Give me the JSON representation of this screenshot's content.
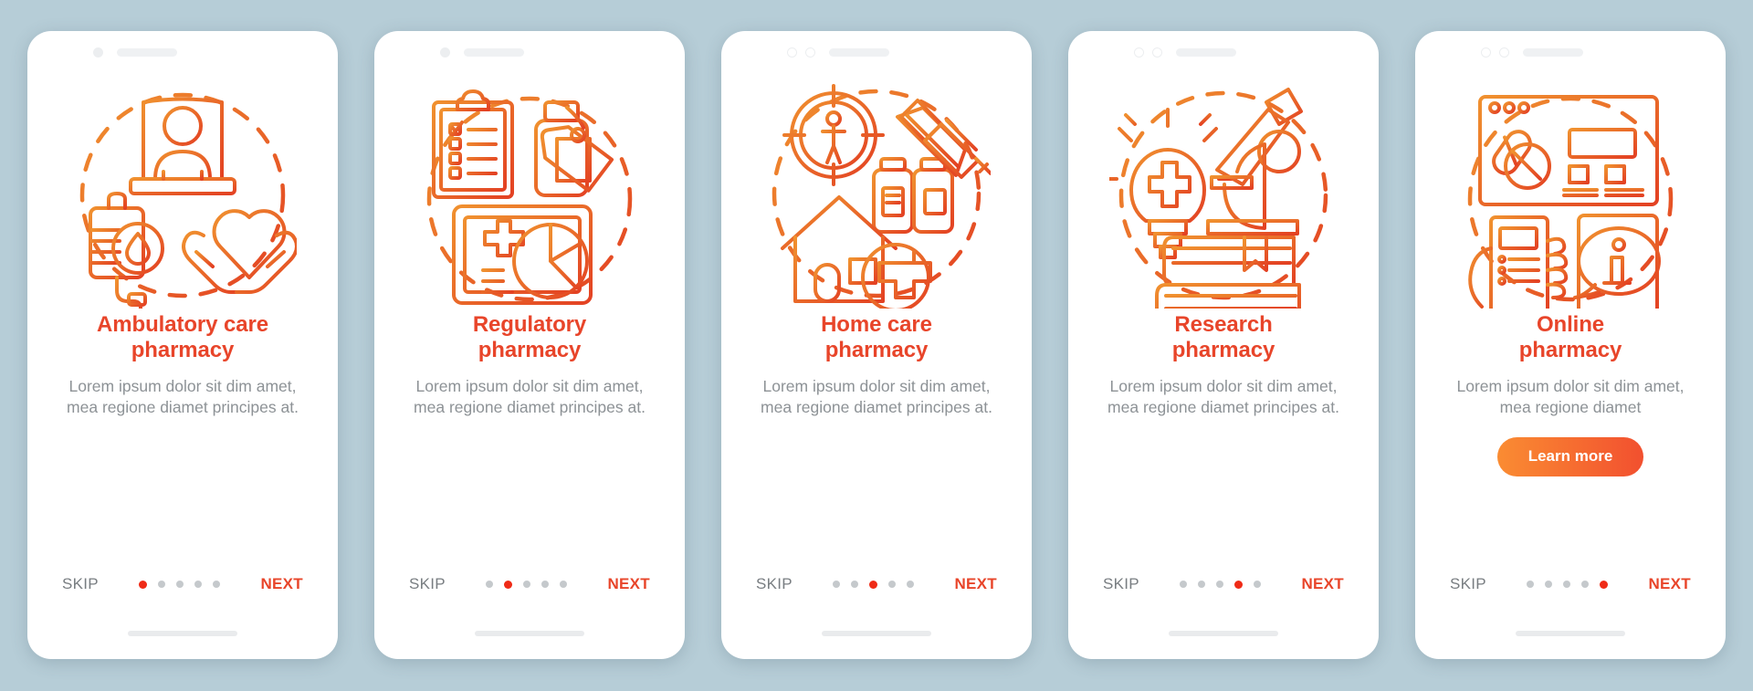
{
  "theme": {
    "background": "#b6cdd7",
    "phone_background": "#ffffff",
    "title_color": "#e8452a",
    "description_color": "#8d9296",
    "skip_color": "#787d81",
    "next_color": "#e8452a",
    "dot_inactive": "#c5c9cc",
    "dot_active": "#ef2b17",
    "cta_gradient_from": "#fa8c32",
    "cta_gradient_to": "#f2502f",
    "icon_gradient_from": "#f0912f",
    "icon_gradient_to": "#e34123"
  },
  "nav": {
    "skip_label": "SKIP",
    "next_label": "NEXT",
    "dot_count": 5
  },
  "screens": [
    {
      "id": "ambulatory-care-pharmacy",
      "title_line1": "Ambulatory care",
      "title_line2": "pharmacy",
      "description": "Lorem ipsum dolor sit dim amet, mea regione diamet principes at.",
      "active_dot": 1,
      "has_cta": false,
      "camera_style": "single-filled",
      "illustration_name": "patient-bed-iv-heart-hands-illustration",
      "illustration_elements": [
        "patient-in-bed-icon",
        "iv-drip-blood-drop-icon",
        "heart-in-hands-icon",
        "dashed-circle"
      ]
    },
    {
      "id": "regulatory-pharmacy",
      "title_line1": "Regulatory",
      "title_line2": "pharmacy",
      "description": "Lorem ipsum dolor sit dim amet, mea regione diamet principes at.",
      "active_dot": 2,
      "has_cta": false,
      "camera_style": "single-filled",
      "illustration_name": "clipboard-bottle-monitor-illustration",
      "illustration_elements": [
        "clipboard-checklist-icon",
        "medicine-bottle-tags-icon",
        "monitor-pie-chart-icon",
        "dashed-circle"
      ]
    },
    {
      "id": "home-care-pharmacy",
      "title_line1": "Home care",
      "title_line2": "pharmacy",
      "description": "Lorem ipsum dolor sit dim amet, mea regione diamet principes at.",
      "active_dot": 3,
      "has_cta": false,
      "camera_style": "double-ring",
      "illustration_name": "target-syringe-house-illustration",
      "illustration_elements": [
        "target-person-icon",
        "syringe-icon",
        "vials-icon",
        "house-medical-cross-icon",
        "dashed-circle"
      ]
    },
    {
      "id": "research-pharmacy",
      "title_line1": "Research",
      "title_line2": "pharmacy",
      "description": "Lorem ipsum dolor sit dim amet, mea regione diamet principes at.",
      "active_dot": 4,
      "has_cta": false,
      "camera_style": "double-ring",
      "illustration_name": "lightbulb-microscope-books-illustration",
      "illustration_elements": [
        "lightbulb-cross-icon",
        "microscope-icon",
        "book-stack-icon",
        "dashed-circle"
      ]
    },
    {
      "id": "online-pharmacy",
      "title_line1": "Online",
      "title_line2": "pharmacy",
      "description": "Lorem ipsum dolor sit dim amet, mea regione diamet",
      "active_dot": 5,
      "has_cta": true,
      "cta_label": "Learn more",
      "camera_style": "double-ring",
      "illustration_name": "browser-phone-info-illustration",
      "illustration_elements": [
        "browser-window-pills-icon",
        "hand-holding-phone-icon",
        "phone-info-bubble-icon",
        "dashed-circle"
      ]
    }
  ]
}
